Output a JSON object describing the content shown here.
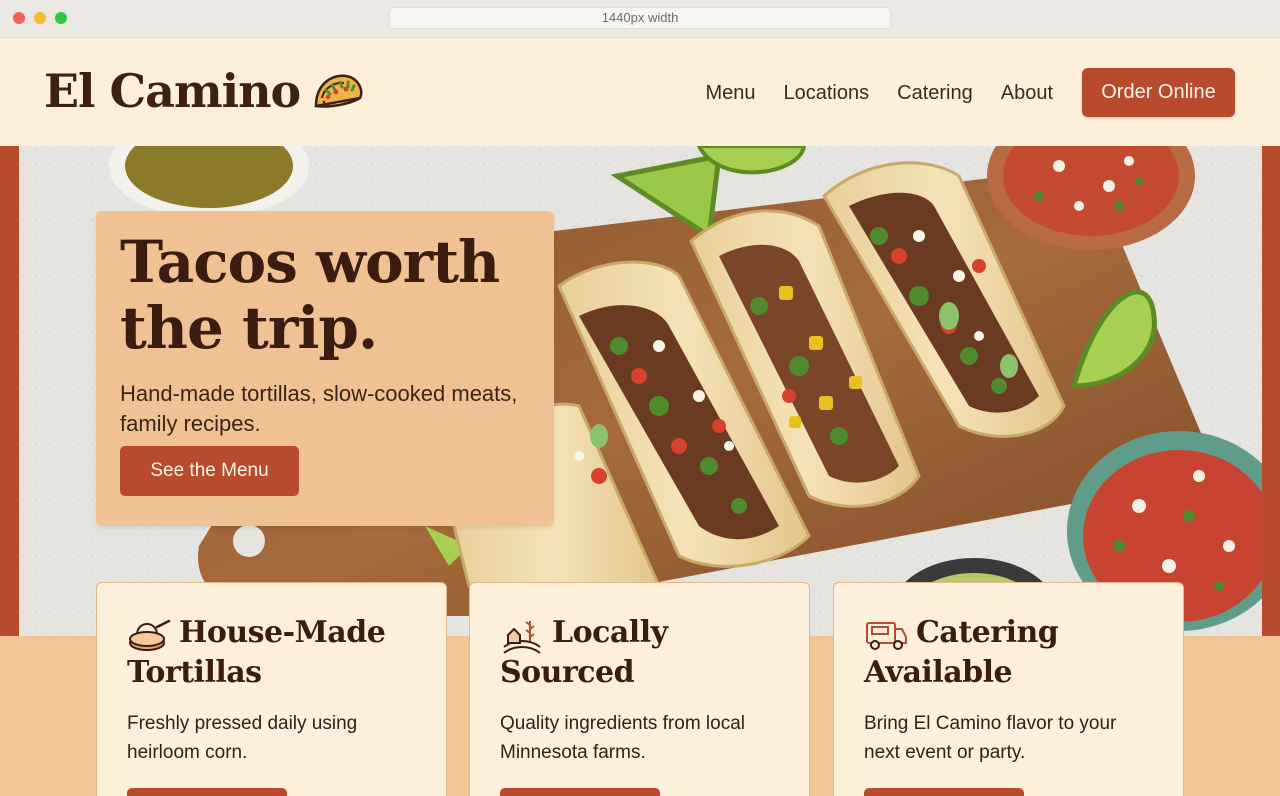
{
  "browser": {
    "url_text": "1440px width"
  },
  "header": {
    "logo": "El Camino",
    "nav": [
      "Menu",
      "Locations",
      "Catering",
      "About"
    ],
    "cta": "Order Online"
  },
  "hero": {
    "title_line1": "Tacos worth",
    "title_line2": "the trip.",
    "subtitle": "Hand-made tortillas, slow-cooked meats, family recipes.",
    "button": "See the Menu"
  },
  "features": [
    {
      "title_line1": "House-Made",
      "title_line2": "Tortillas",
      "description": "Freshly pressed daily using heirloom corn.",
      "icon": "tortilla-press-icon"
    },
    {
      "title_line1": "Locally",
      "title_line2": "Sourced",
      "description": "Quality ingredients from local Minnesota farms.",
      "icon": "farm-icon"
    },
    {
      "title_line1": "Catering",
      "title_line2": "Available",
      "description": "Bring El Camino flavor to your next event or party.",
      "icon": "food-truck-icon"
    }
  ],
  "colors": {
    "brand": "#b84a2e",
    "cream": "#fdefd9",
    "tan": "#f0c293",
    "text": "#3a1d10"
  }
}
